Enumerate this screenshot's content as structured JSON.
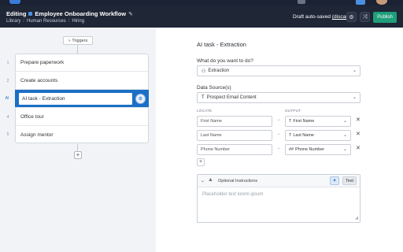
{
  "header": {
    "editing": "Editing",
    "workflow_name": "Employee Onboarding Workflow",
    "breadcrumb": [
      "Library",
      "Human Resources",
      "Hiring"
    ],
    "autosave_text": "Draft auto-saved",
    "discard": "(discard)",
    "publish": "Publish"
  },
  "canvas": {
    "triggers": "Triggers",
    "steps": [
      {
        "num": "1",
        "label": "Prepare paperwork"
      },
      {
        "num": "2",
        "label": "Create accounts"
      },
      {
        "num": "AI",
        "label": "AI task - Extraction"
      },
      {
        "num": "4",
        "label": "Office tour"
      },
      {
        "num": "5",
        "label": "Assign mentor"
      }
    ]
  },
  "panel": {
    "title": "AI task - Extraction",
    "question": "What do you want to do?",
    "task_value": "Extraction",
    "sources_label": "Data Source(s)",
    "source_value": "Prospect Email Content",
    "locate_header": "LOCATE",
    "output_header": "OUTPUT",
    "rows": [
      {
        "locate": "First Name",
        "output": "First Name",
        "output_icon": "T"
      },
      {
        "locate": "Last Name",
        "output": "Last Name",
        "output_icon": "T"
      },
      {
        "locate": "Phone Number",
        "output": "Phone Number",
        "output_icon": "##"
      }
    ],
    "instructions": {
      "title": "Optional Instructions",
      "text_button": "Text",
      "placeholder": "Placeholder text lorem ipsum"
    }
  },
  "colors": {
    "header_bg": "#1f2636",
    "accent": "#1b6fc6",
    "publish": "#1f9e7a"
  }
}
